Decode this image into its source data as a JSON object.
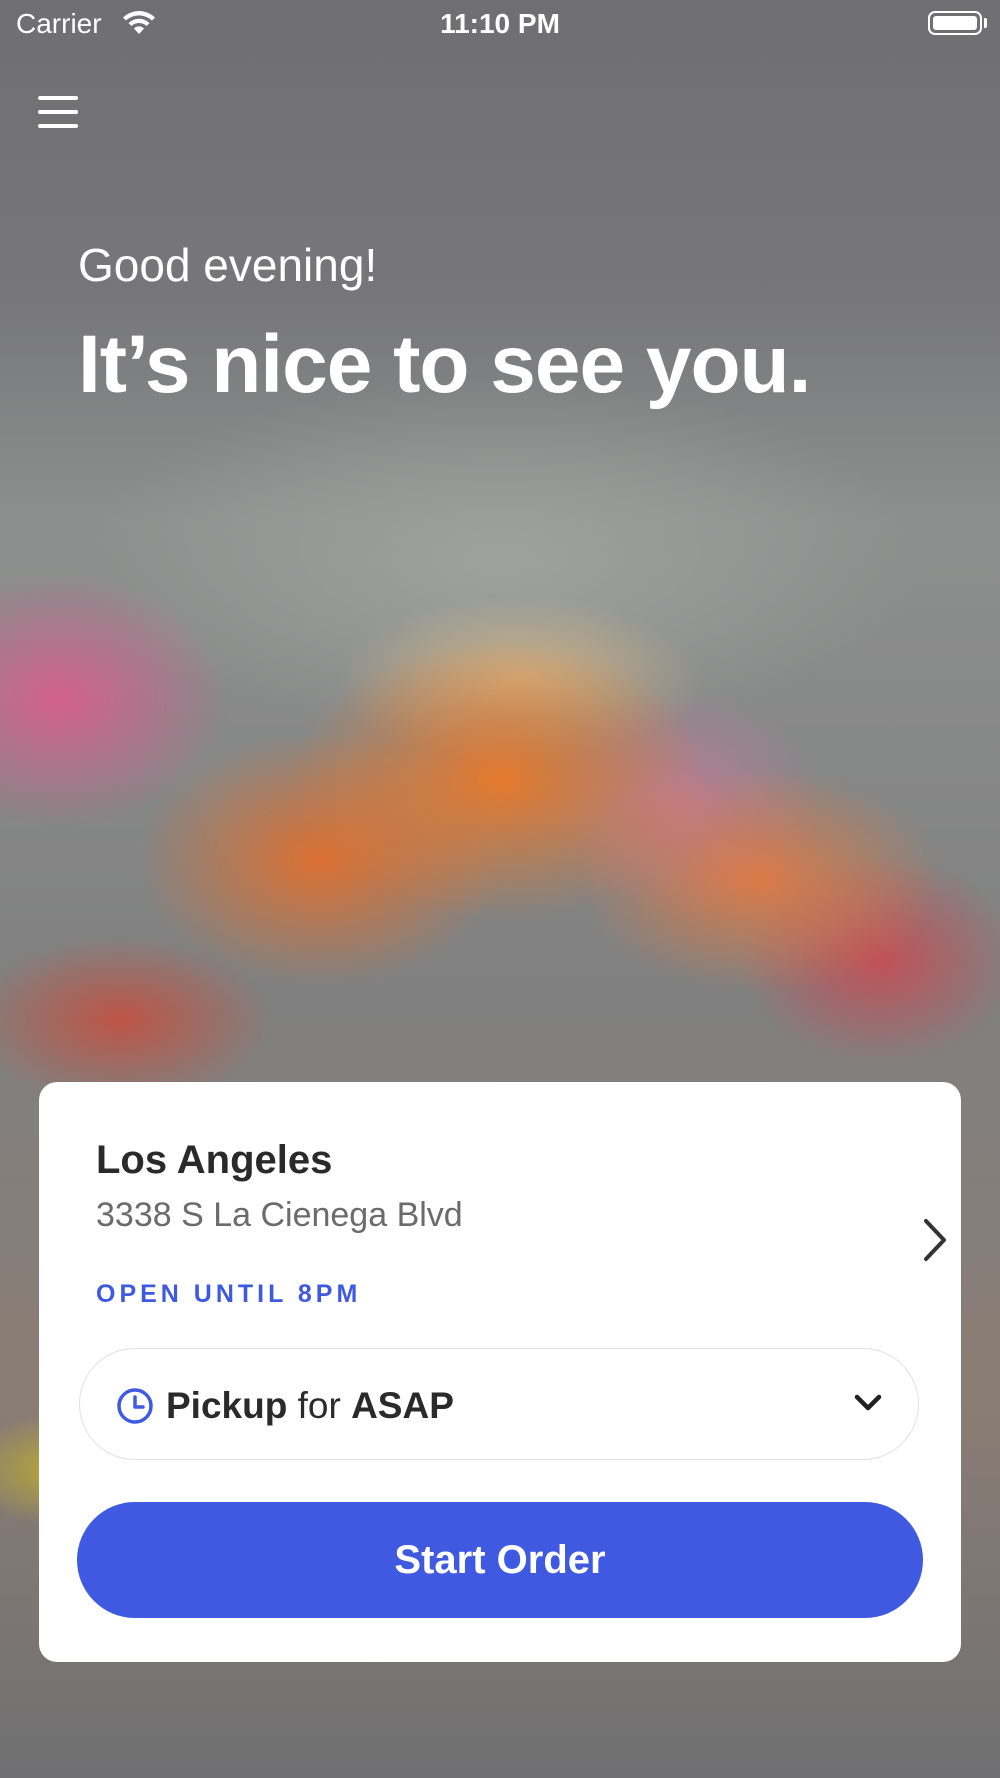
{
  "status_bar": {
    "carrier": "Carrier",
    "time": "11:10 PM",
    "icons": [
      "wifi-icon",
      "battery-icon"
    ]
  },
  "header": {
    "menu_icon": "hamburger-menu-icon"
  },
  "hero": {
    "greeting": "Good evening!",
    "headline": "It’s nice to see you."
  },
  "location": {
    "city": "Los Angeles",
    "address": "3338 S La Cienega Blvd",
    "hours": "OPEN UNTIL 8PM",
    "icon": "chevron-right-icon"
  },
  "order_mode": {
    "icon": "clock-icon",
    "mode": "Pickup",
    "connector": "for",
    "time": "ASAP",
    "dropdown_icon": "chevron-down-icon"
  },
  "actions": {
    "start_order": "Start Order"
  },
  "colors": {
    "accent": "#3f5ae0",
    "card_bg": "#ffffff",
    "text_dark": "#2a2a2a",
    "text_muted": "#6b6b6b"
  }
}
